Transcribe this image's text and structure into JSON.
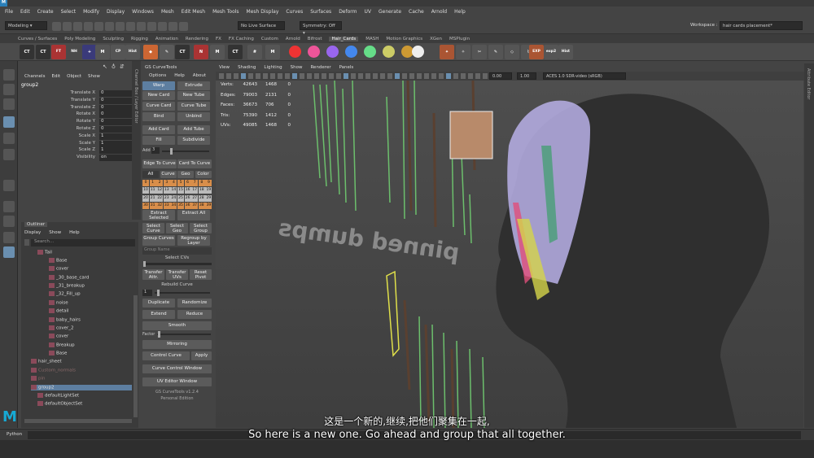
{
  "app": {
    "logo_small": "M",
    "logo_big": "M"
  },
  "menu": [
    "File",
    "Edit",
    "Create",
    "Select",
    "Modify",
    "Display",
    "Windows",
    "Mesh",
    "Edit Mesh",
    "Mesh Tools",
    "Mesh Display",
    "Curves",
    "Surfaces",
    "Deform",
    "UV",
    "Generate",
    "Cache",
    "Arnold",
    "Help"
  ],
  "status": {
    "mode": "Modeling",
    "live": "No Live Surface",
    "symmetry": "Symmetry: Off",
    "workspace_label": "Workspace :",
    "workspace": "hair cards placement*"
  },
  "shelf_tabs": [
    "Curves / Surfaces",
    "Poly Modeling",
    "Sculpting",
    "Rigging",
    "Animation",
    "Rendering",
    "FX",
    "FX Caching",
    "Custom",
    "Arnold",
    "Bifrost",
    "Hair_Cards",
    "MASH",
    "Motion Graphics",
    "XGen",
    "MSPlugin"
  ],
  "shelf_active": "Hair_Cards",
  "shelf_labels": {
    "ft": "FT",
    "nh": "NH",
    "cp": "CP",
    "hist": "Hist",
    "exp": "EXP",
    "exp2": "exp2",
    "hist2": "Hist"
  },
  "channel_box": {
    "menu": [
      "Channels",
      "Edit",
      "Object",
      "Show"
    ],
    "object": "group2",
    "attrs": [
      {
        "name": "Translate X",
        "value": "0"
      },
      {
        "name": "Translate Y",
        "value": "0"
      },
      {
        "name": "Translate Z",
        "value": "0"
      },
      {
        "name": "Rotate X",
        "value": "0"
      },
      {
        "name": "Rotate Y",
        "value": "0"
      },
      {
        "name": "Rotate Z",
        "value": "0"
      },
      {
        "name": "Scale X",
        "value": "1"
      },
      {
        "name": "Scale Y",
        "value": "1"
      },
      {
        "name": "Scale Z",
        "value": "1"
      },
      {
        "name": "Visibility",
        "value": "on"
      }
    ],
    "side_tab": "Channel Box / Layer Editor"
  },
  "outliner": {
    "title": "Outliner",
    "menu": [
      "Display",
      "Show",
      "Help"
    ],
    "search": "Search...",
    "items": [
      {
        "label": "Tail"
      },
      {
        "label": "Base"
      },
      {
        "label": "cover"
      },
      {
        "label": "_30_base_card"
      },
      {
        "label": "_31_breakup"
      },
      {
        "label": "_32_Fill_up"
      },
      {
        "label": "noise"
      },
      {
        "label": "detail"
      },
      {
        "label": "baby_hairs"
      },
      {
        "label": "cover_2"
      },
      {
        "label": "cover"
      },
      {
        "label": "Breakup"
      },
      {
        "label": "Base"
      },
      {
        "label": "hair_sheet"
      },
      {
        "label": "Custom_normals"
      },
      {
        "label": "pin"
      },
      {
        "label": "group2"
      },
      {
        "label": "defaultLightSet"
      },
      {
        "label": "defaultObjectSet"
      }
    ]
  },
  "gs": {
    "title": "GS CurveTools",
    "menu": [
      "Options",
      "Help",
      "About"
    ],
    "warp": "Warp",
    "extrude": "Extrude",
    "new_card": "New Card",
    "new_tube": "New Tube",
    "curve_card": "Curve Card",
    "curve_tube": "Curve Tube",
    "bind": "Bind",
    "unbind": "Unbind",
    "add_card": "Add Card",
    "add_tube": "Add Tube",
    "fill": "Fill",
    "subdivide": "Subdivide",
    "add_label": "Add",
    "add_value": "3",
    "edge_to_curve": "Edge To Curve",
    "card_to_curve": "Card To Curve",
    "filter": [
      "All",
      "Curve",
      "Geo",
      "Color"
    ],
    "layers": [
      "0",
      "1",
      "2",
      "3",
      "4",
      "5",
      "6",
      "7",
      "8",
      "9",
      "10",
      "11",
      "12",
      "13",
      "14",
      "15",
      "16",
      "17",
      "18",
      "19",
      "20",
      "21",
      "22",
      "23",
      "24",
      "25",
      "26",
      "27",
      "28",
      "29",
      "30",
      "31",
      "32",
      "33",
      "34",
      "35",
      "36",
      "37",
      "38",
      "39"
    ],
    "extract_selected": "Extract Selected",
    "extract_all": "Extract All",
    "select_curve": "Select Curve",
    "select_geo": "Select Geo",
    "select_group": "Select Group",
    "group_curves": "Group Curves",
    "regroup": "Regroup by Layer",
    "group_name": "Group Name",
    "select_cvs": "Select CVs",
    "transfer_attr": "Transfer Attr.",
    "transfer_uvs": "Transfer UVs",
    "reset_pivot": "Reset Pivot",
    "rebuild_curve": "Rebuild Curve",
    "rebuild_value": "1",
    "duplicate": "Duplicate",
    "randomize": "Randomize",
    "extend": "Extend",
    "reduce": "Reduce",
    "smooth": "Smooth",
    "factor": "Factor",
    "mirroring": "Mirroring",
    "control_curve": "Control Curve",
    "apply": "Apply",
    "curve_control_window": "Curve Control Window",
    "uv_editor_window": "UV Editor Window",
    "version": "GS CurveTools v1.2.4",
    "edition": "Personal Edition"
  },
  "viewport": {
    "menu": [
      "View",
      "Shading",
      "Lighting",
      "Show",
      "Renderer",
      "Panels"
    ],
    "hud": [
      {
        "k": "Verts:",
        "a": "42643",
        "b": "1468",
        "c": "0"
      },
      {
        "k": "Edges:",
        "a": "79003",
        "b": "2131",
        "c": "0"
      },
      {
        "k": "Faces:",
        "a": "36673",
        "b": "706",
        "c": "0"
      },
      {
        "k": "Tris:",
        "a": "75390",
        "b": "1412",
        "c": "0"
      },
      {
        "k": "UVs:",
        "a": "49085",
        "b": "1468",
        "c": "0"
      }
    ],
    "field1": "0.00",
    "field2": "1.00",
    "colorspace": "ACES 1.0 SDR-video (sRGB)",
    "text3d": "pinned dumps",
    "side_tab": "Attribute Editor"
  },
  "cmdline": {
    "label": "Python"
  },
  "subtitles": {
    "zh": "这是一个新的,继续,把他们聚集在一起,",
    "en": "So here is a new one. Go ahead and group that all together."
  }
}
